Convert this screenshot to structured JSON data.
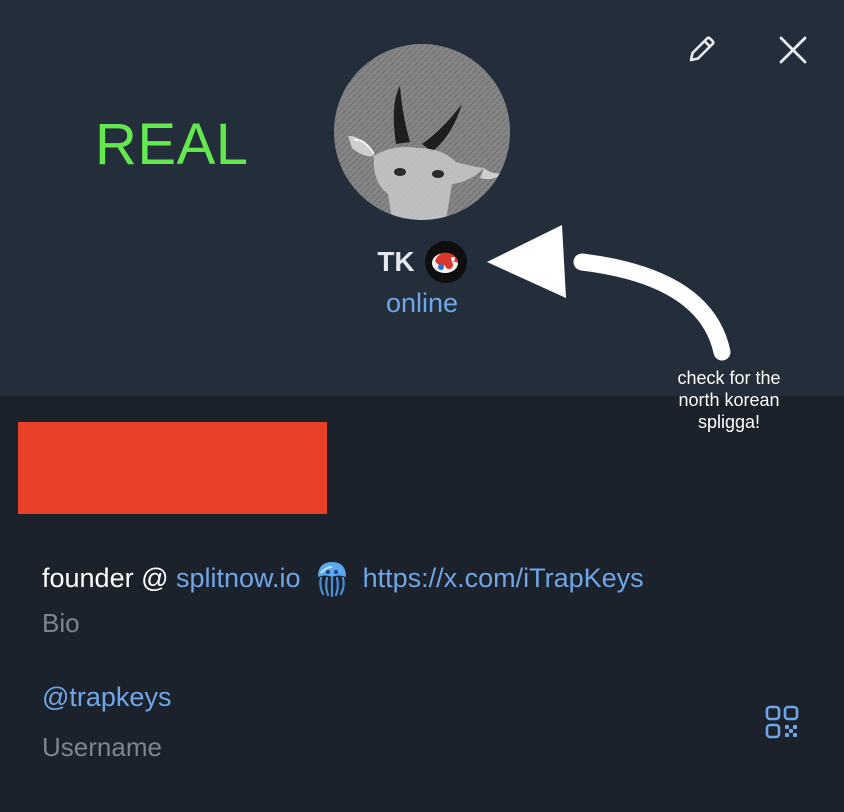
{
  "overlay_label": "REAL",
  "profile": {
    "name": "TK",
    "status": "online",
    "emoji_status_icon": "red-creature-emoji-icon"
  },
  "annotation": {
    "line1": "check for the",
    "line2": "north korean",
    "line3": "spligga!"
  },
  "bio": {
    "prefix": "founder @ ",
    "link1": "splitnow.io",
    "emoji": "jellyfish-emoji",
    "link2": "https://x.com/iTrapKeys",
    "caption": "Bio"
  },
  "username": {
    "value": "@trapkeys",
    "caption": "Username"
  },
  "colors": {
    "header_bg": "#242e3b",
    "body_bg": "#1c222b",
    "accent_link": "#6fa6e8",
    "overlay_green": "#63e84f",
    "redaction_red": "#e84127"
  }
}
